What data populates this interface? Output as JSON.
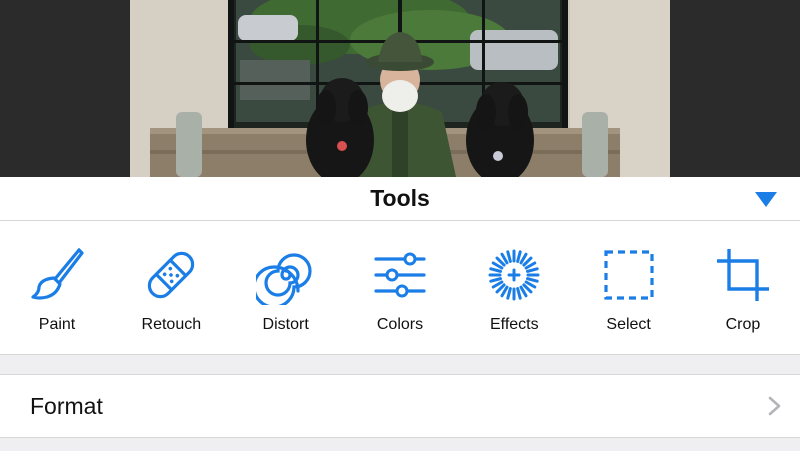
{
  "panel": {
    "title": "Tools",
    "tools": [
      {
        "label": "Paint",
        "icon": "paintbrush-icon"
      },
      {
        "label": "Retouch",
        "icon": "bandage-icon"
      },
      {
        "label": "Distort",
        "icon": "spiral-icon"
      },
      {
        "label": "Colors",
        "icon": "sliders-icon"
      },
      {
        "label": "Effects",
        "icon": "effects-dial-icon"
      },
      {
        "label": "Select",
        "icon": "dashed-selection-icon"
      },
      {
        "label": "Crop",
        "icon": "crop-icon"
      }
    ],
    "format_label": "Format"
  },
  "colors": {
    "accent": "#1a7ee6",
    "panel_bg": "#ffffff",
    "separator_bg": "#efeff2",
    "canvas_bg": "#2b2b2b"
  }
}
